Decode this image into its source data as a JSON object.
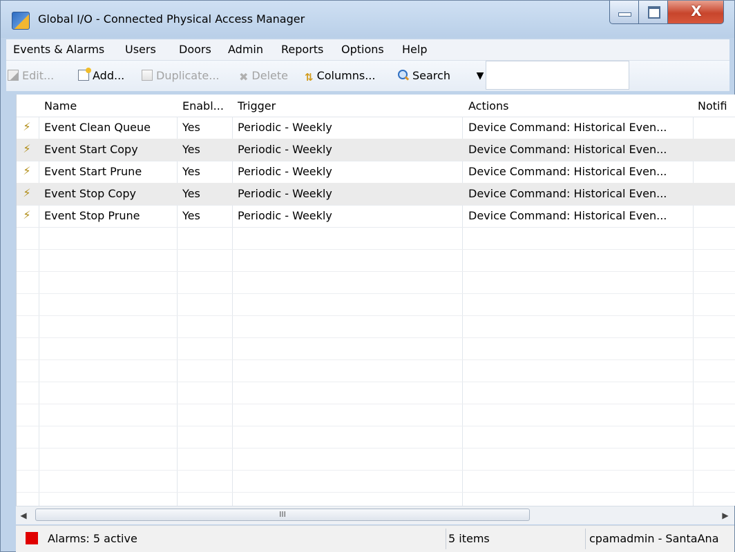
{
  "window": {
    "title": "Global I/O - Connected Physical Access Manager",
    "close_glyph": "X"
  },
  "menu": [
    "Events & Alarms",
    "Users",
    "Doors",
    "Admin",
    "Reports",
    "Options",
    "Help"
  ],
  "toolbar": {
    "edit": "Edit...",
    "add": "Add...",
    "duplicate": "Duplicate...",
    "delete": "Delete",
    "columns": "Columns...",
    "search": "Search",
    "search_value": ""
  },
  "table": {
    "columns": [
      "Name",
      "Enabl...",
      "Trigger",
      "Actions",
      "Notifi"
    ],
    "rows": [
      {
        "name": "Event Clean Queue",
        "enabled": "Yes",
        "trigger": "Periodic - Weekly",
        "actions": "Device Command: Historical Even..."
      },
      {
        "name": "Event Start Copy",
        "enabled": "Yes",
        "trigger": "Periodic - Weekly",
        "actions": "Device Command: Historical Even..."
      },
      {
        "name": "Event Start Prune",
        "enabled": "Yes",
        "trigger": "Periodic - Weekly",
        "actions": "Device Command: Historical Even..."
      },
      {
        "name": "Event Stop Copy",
        "enabled": "Yes",
        "trigger": "Periodic - Weekly",
        "actions": "Device Command: Historical Even..."
      },
      {
        "name": "Event Stop Prune",
        "enabled": "Yes",
        "trigger": "Periodic - Weekly",
        "actions": "Device Command: Historical Even..."
      }
    ]
  },
  "scrollbar": {
    "grip": "III"
  },
  "status": {
    "alarms": "Alarms: 5 active",
    "items": "5 items",
    "user": "cpamadmin - SantaAna",
    "alarm_color": "#e00000"
  }
}
